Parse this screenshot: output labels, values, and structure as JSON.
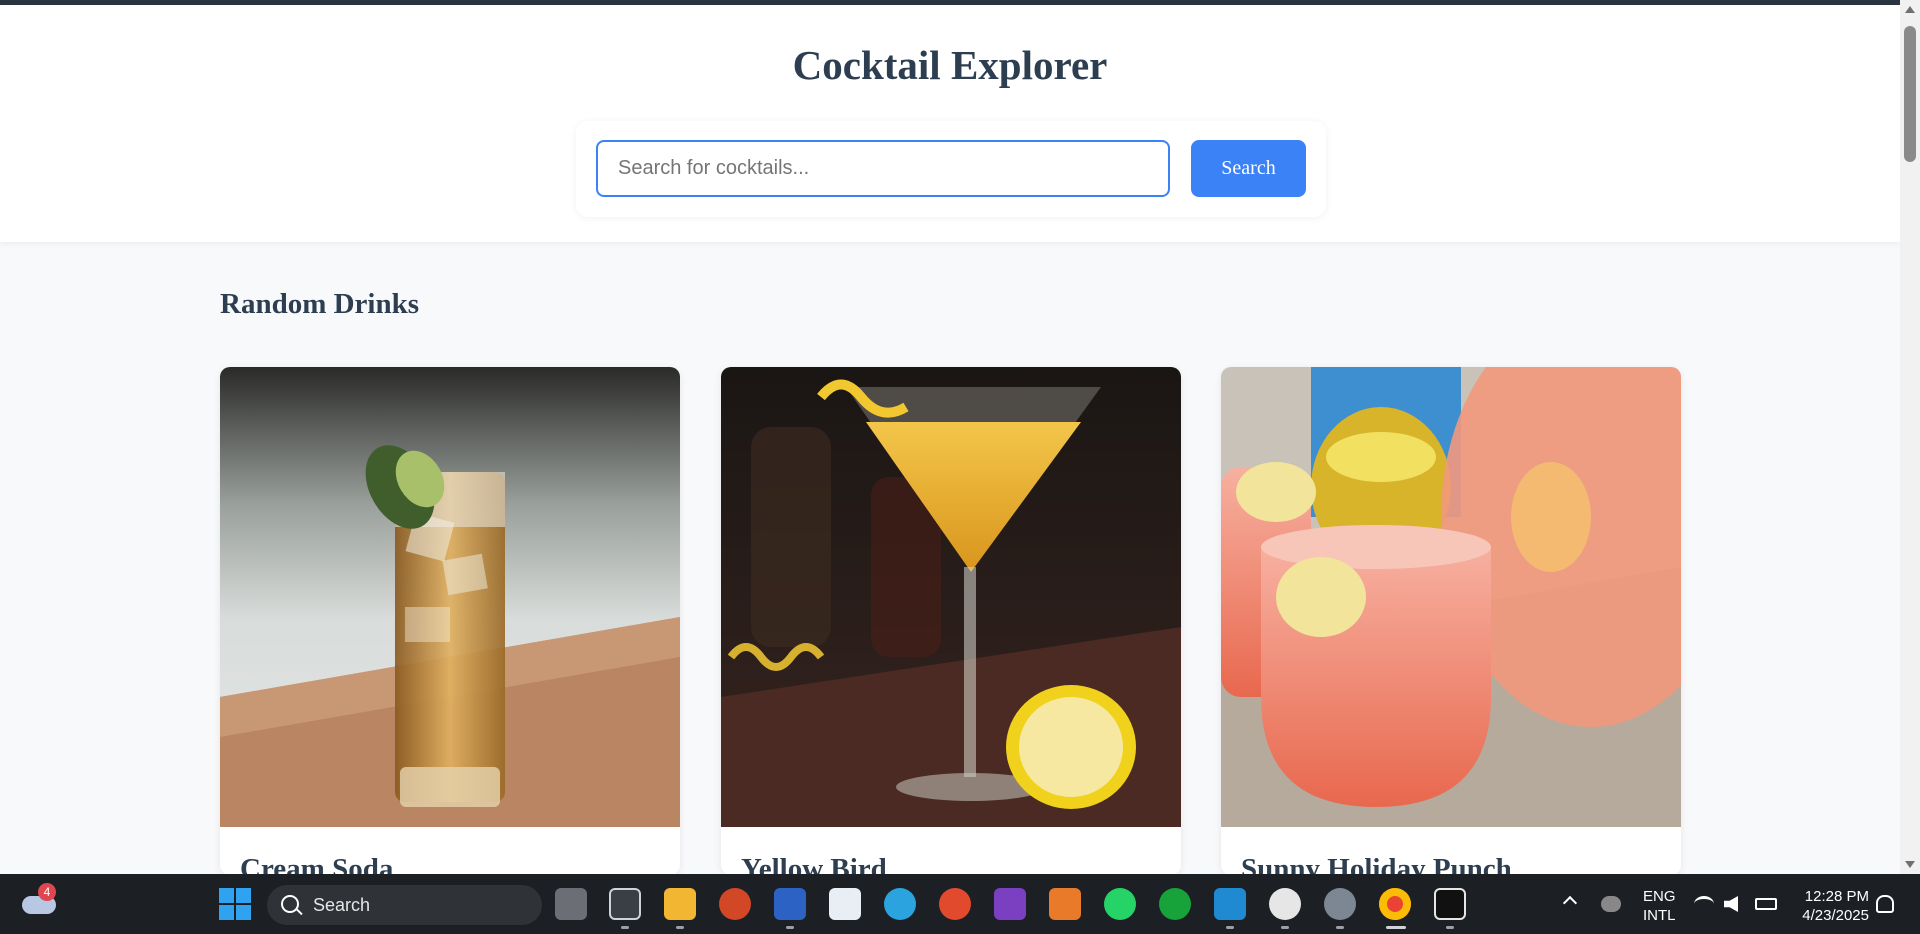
{
  "app": {
    "title": "Cocktail Explorer"
  },
  "search": {
    "placeholder": "Search for cocktails...",
    "value": "",
    "button_label": "Search",
    "accent_color": "#3b82f6"
  },
  "section": {
    "title": "Random Drinks"
  },
  "drinks": [
    {
      "name": "Cream Soda",
      "image": "tall-glass-cocktail-with-lime"
    },
    {
      "name": "Yellow Bird",
      "image": "martini-glass-yellow-with-lemon"
    },
    {
      "name": "Sunny Holiday Punch",
      "image": "pink-punch-with-lemon-and-pineapple"
    }
  ],
  "taskbar": {
    "weather_badge": "4",
    "search_label": "Search",
    "language_line1": "ENG",
    "language_line2": "INTL",
    "time": "12:28 PM",
    "date": "4/23/2025",
    "apps": [
      "file-explorer",
      "acs",
      "folder",
      "powerpoint",
      "word",
      "store",
      "telegram",
      "app-red",
      "app-purple",
      "app-orange",
      "whatsapp",
      "xbox",
      "vscode",
      "slack",
      "settings",
      "chrome",
      "app-dark"
    ]
  }
}
